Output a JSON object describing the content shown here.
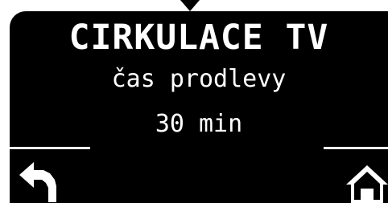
{
  "screen": {
    "title": "CIRKULACE TV",
    "subtitle": "čas prodlevy",
    "value": "30 min"
  },
  "icons": {
    "back": "back-arrow-icon",
    "home": "home-icon"
  },
  "colors": {
    "background": "#000000",
    "foreground": "#ffffff"
  }
}
